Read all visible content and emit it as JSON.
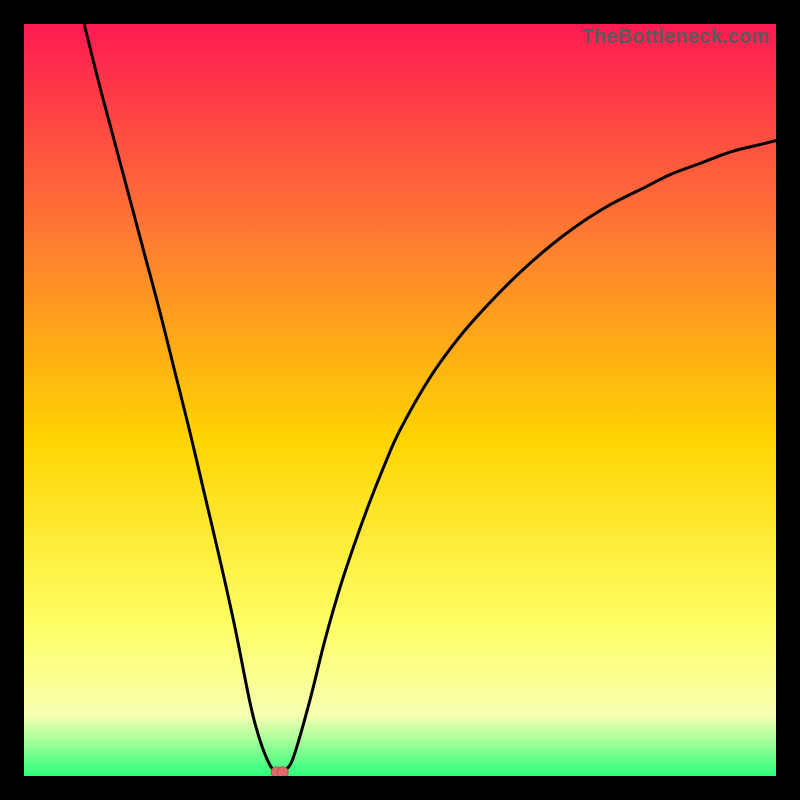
{
  "watermark": "TheBottleneck.com",
  "colors": {
    "frame": "#000000",
    "gradient_top": "#ff1a52",
    "gradient_upper_mid": "#ff7a33",
    "gradient_mid": "#ffd400",
    "gradient_lower_mid": "#ffff66",
    "gradient_low": "#f6ffb0",
    "gradient_bottom": "#2cff7a",
    "curve": "#000000",
    "marker_fill": "#e06a6a",
    "marker_stroke": "#c94f4f"
  },
  "chart_data": {
    "type": "line",
    "title": "",
    "xlabel": "",
    "ylabel": "",
    "xlim": [
      0,
      100
    ],
    "ylim": [
      0,
      100
    ],
    "curve": {
      "x": [
        8,
        10,
        12,
        14,
        16,
        18,
        20,
        22,
        24,
        26,
        28,
        30,
        31,
        32,
        33,
        34,
        35,
        36,
        38,
        40,
        42,
        44,
        46,
        48,
        50,
        54,
        58,
        62,
        66,
        70,
        74,
        78,
        82,
        86,
        90,
        94,
        98,
        100
      ],
      "y": [
        100,
        92,
        84.5,
        77,
        69.5,
        62,
        54,
        46,
        37.5,
        29,
        20,
        10,
        6,
        3,
        1,
        0.5,
        1,
        3,
        10,
        18,
        25,
        31,
        36.5,
        41.5,
        46,
        53,
        58.5,
        63,
        67,
        70.5,
        73.5,
        76,
        78,
        80,
        81.5,
        83,
        84,
        84.5
      ]
    },
    "marker": {
      "x": 34,
      "y": 0.5
    },
    "gradient_stops": [
      {
        "pos": 0.0,
        "color": "#ff1a52"
      },
      {
        "pos": 0.28,
        "color": "#ff7a33"
      },
      {
        "pos": 0.55,
        "color": "#ffd400"
      },
      {
        "pos": 0.8,
        "color": "#ffff66"
      },
      {
        "pos": 0.92,
        "color": "#f6ffb0"
      },
      {
        "pos": 1.0,
        "color": "#2cff7a"
      }
    ]
  }
}
